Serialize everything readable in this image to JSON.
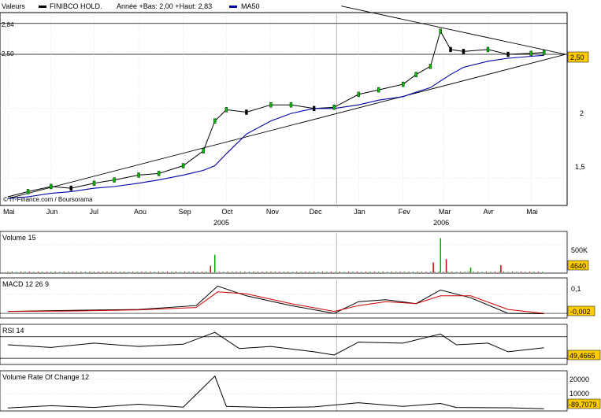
{
  "header": {
    "valeurs_label": "Valeurs",
    "stock_name": "FINIBCO HOLD.",
    "range_text": "Année +Bas: 2,00 +Haut: 2,83",
    "ma_label": "MA50"
  },
  "copyright": "© IT-Finance.com / Boursorama",
  "colors": {
    "price": "#000000",
    "up_candle": "#00bb00",
    "down_candle": "#000000",
    "ma": "#0000aa",
    "macd_signal": "#cc0000",
    "volume_up": "#00aa00",
    "volume_down": "#cc0000",
    "value_box": "#ffcc00",
    "grid": "#c8c8c8"
  },
  "chart_data": [
    {
      "type": "line",
      "name_label": "FINIBCO HOLD.",
      "x": [
        "2005-05-02",
        "2005-05-16",
        "2005-06-01",
        "2005-06-15",
        "2005-07-01",
        "2005-07-15",
        "2005-08-01",
        "2005-08-15",
        "2005-09-01",
        "2005-09-15",
        "2005-09-23",
        "2005-10-01",
        "2005-10-15",
        "2005-11-01",
        "2005-11-15",
        "2005-12-01",
        "2005-12-15",
        "2006-01-01",
        "2006-01-15",
        "2006-02-01",
        "2006-02-10",
        "2006-02-20",
        "2006-02-27",
        "2006-03-06",
        "2006-03-15",
        "2006-04-01",
        "2006-04-15",
        "2006-05-01",
        "2006-05-10"
      ],
      "series": [
        {
          "name": "FINIBCO HOLD.",
          "values": [
            1.39,
            1.42,
            1.45,
            1.44,
            1.47,
            1.49,
            1.52,
            1.53,
            1.58,
            1.68,
            1.9,
            1.99,
            1.97,
            2.03,
            2.03,
            2.0,
            2.01,
            2.12,
            2.16,
            2.21,
            2.3,
            2.38,
            2.75,
            2.55,
            2.53,
            2.55,
            2.5,
            2.51,
            2.52
          ]
        },
        {
          "name": "MA50",
          "values": [
            1.38,
            1.39,
            1.41,
            1.42,
            1.44,
            1.45,
            1.47,
            1.49,
            1.52,
            1.55,
            1.58,
            1.66,
            1.8,
            1.9,
            1.96,
            2.0,
            2.0,
            2.03,
            2.07,
            2.1,
            2.14,
            2.18,
            2.24,
            2.3,
            2.37,
            2.43,
            2.46,
            2.48,
            2.49
          ]
        }
      ],
      "y_ticks": [
        "1,5",
        "2",
        "2,5"
      ],
      "reference_levels": [
        {
          "label": "2,84",
          "value": 2.84
        },
        {
          "label": "2,50",
          "value": 2.5
        }
      ],
      "last_value_label": "2,50",
      "ylim": [
        1.35,
        2.95
      ],
      "scale": "log",
      "x_months": [
        "Mai",
        "Jun",
        "Jul",
        "Aou",
        "Sep",
        "Oct",
        "Nov",
        "Dec",
        "Jan",
        "Fev",
        "Mar",
        "Avr",
        "Mai"
      ],
      "x_years": [
        "2005",
        "2006"
      ],
      "trendlines": [
        {
          "from": [
            "2005-05-02",
            1.38
          ],
          "to": [
            "2006-05-25",
            2.5
          ]
        },
        {
          "from": [
            "2005-12-20",
            3.05
          ],
          "to": [
            "2006-05-25",
            2.5
          ]
        }
      ],
      "grid": true
    },
    {
      "type": "bar",
      "title": "Volume 15",
      "y_tick": "500K",
      "last_value_label": "4640",
      "note": "spikes",
      "x": [
        "2005-09-20",
        "2005-09-23",
        "2006-02-22",
        "2006-02-27",
        "2006-03-03",
        "2006-03-20",
        "2006-04-10"
      ],
      "values": [
        120000,
        320000,
        180000,
        620000,
        240000,
        90000,
        130000
      ],
      "baseline": 15000
    },
    {
      "type": "line",
      "title": "MACD 12 26 9",
      "y_tick": "0,1",
      "last_value_label": "-0,002",
      "x": [
        "2005-05-02",
        "2005-06-15",
        "2005-08-01",
        "2005-09-10",
        "2005-09-25",
        "2005-10-15",
        "2005-11-15",
        "2005-12-15",
        "2006-01-01",
        "2006-01-20",
        "2006-02-10",
        "2006-02-27",
        "2006-03-20",
        "2006-04-15",
        "2006-05-10"
      ],
      "series": [
        {
          "name": "MACD",
          "values": [
            0.01,
            0.015,
            0.02,
            0.04,
            0.14,
            0.09,
            0.04,
            0.0,
            0.06,
            0.07,
            0.05,
            0.12,
            0.08,
            0.0,
            -0.002
          ]
        },
        {
          "name": "Signal",
          "values": [
            0.01,
            0.012,
            0.018,
            0.03,
            0.11,
            0.1,
            0.05,
            0.01,
            0.04,
            0.06,
            0.05,
            0.09,
            0.09,
            0.02,
            0.0
          ]
        }
      ],
      "ylim": [
        -0.02,
        0.17
      ]
    },
    {
      "type": "line",
      "title": "RSI 14",
      "last_value_label": "49,4665",
      "x": [
        "2005-05-02",
        "2005-06-01",
        "2005-07-01",
        "2005-08-01",
        "2005-09-01",
        "2005-09-23",
        "2005-10-10",
        "2005-11-01",
        "2005-12-01",
        "2005-12-15",
        "2006-01-01",
        "2006-02-01",
        "2006-02-27",
        "2006-03-10",
        "2006-04-01",
        "2006-04-15",
        "2006-05-10"
      ],
      "values": [
        55,
        50,
        58,
        52,
        56,
        78,
        48,
        52,
        42,
        36,
        60,
        58,
        75,
        55,
        58,
        42,
        49.47
      ],
      "ylim": [
        20,
        90
      ],
      "reference_levels": [
        70,
        30
      ]
    },
    {
      "type": "line",
      "title": "Volume Rate Of Change 12",
      "y_ticks": [
        "20000",
        "10000"
      ],
      "last_value_label": "-89,7079",
      "x": [
        "2005-05-02",
        "2005-06-01",
        "2005-07-01",
        "2005-08-01",
        "2005-09-01",
        "2005-09-23",
        "2005-10-01",
        "2005-11-01",
        "2005-12-01",
        "2006-01-01",
        "2006-02-01",
        "2006-02-27",
        "2006-03-10",
        "2006-04-15",
        "2006-05-10"
      ],
      "values": [
        500,
        2000,
        800,
        3000,
        1000,
        22000,
        1500,
        700,
        1200,
        4000,
        1500,
        3500,
        800,
        600,
        -89.7
      ],
      "ylim": [
        -1000,
        24000
      ]
    }
  ]
}
